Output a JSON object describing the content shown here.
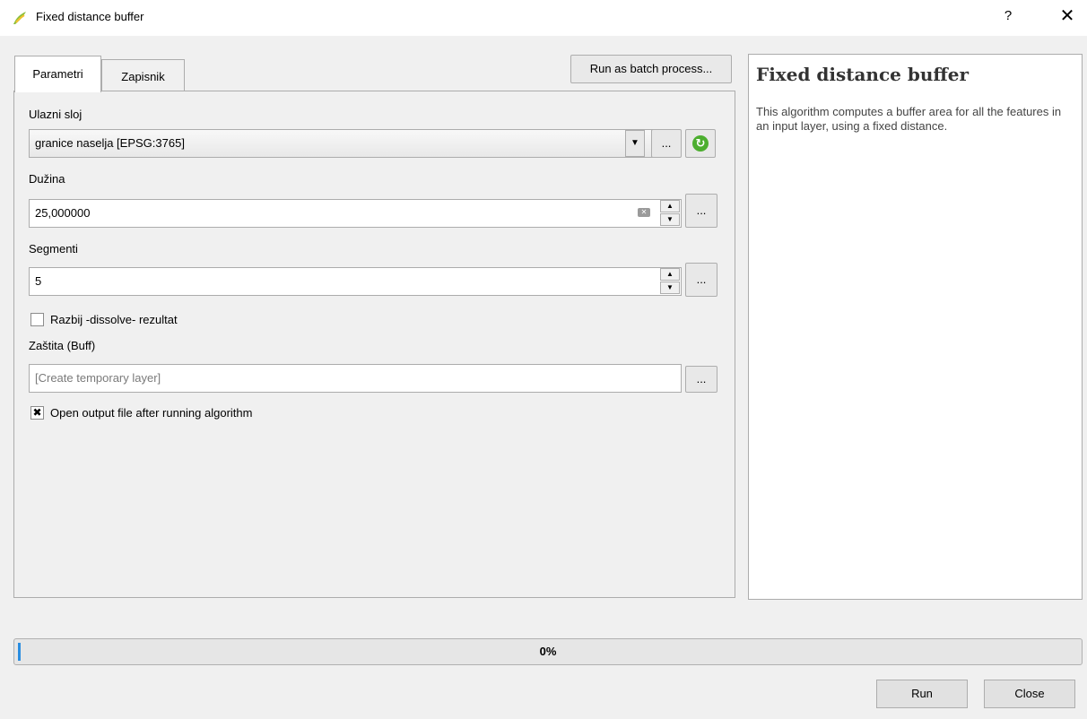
{
  "window": {
    "title": "Fixed distance buffer",
    "help_glyph": "?",
    "close_glyph": "✕",
    "app_icon": "qgis-icon"
  },
  "tabs": [
    {
      "label": "Parametri",
      "active": true
    },
    {
      "label": "Zapisnik",
      "active": false
    }
  ],
  "batch_button": "Run as batch process...",
  "params": {
    "input_layer": {
      "label": "Ulazni sloj",
      "value": "granice naselja [EPSG:3765]",
      "browse": "..."
    },
    "distance": {
      "label": "Dužina",
      "value": "25,000000",
      "browse": "..."
    },
    "segments": {
      "label": "Segmenti",
      "value": "5",
      "browse": "..."
    },
    "dissolve": {
      "label": "Razbij -dissolve- rezultat",
      "checked": false
    },
    "output": {
      "label": "Zaštita (Buff)",
      "placeholder": "[Create temporary layer]",
      "browse": "..."
    },
    "open_output": {
      "label": "Open output file after running algorithm",
      "checked": true,
      "check_glyph": "✖"
    }
  },
  "help": {
    "title": "Fixed distance buffer",
    "text": "This algorithm computes a buffer area for all the features in an input layer, using a fixed distance."
  },
  "progress": {
    "value": 0,
    "text": "0%"
  },
  "buttons": {
    "run": "Run",
    "close": "Close"
  },
  "colors": {
    "accent": "#2a8de0",
    "reload_green": "#4cae2f"
  }
}
